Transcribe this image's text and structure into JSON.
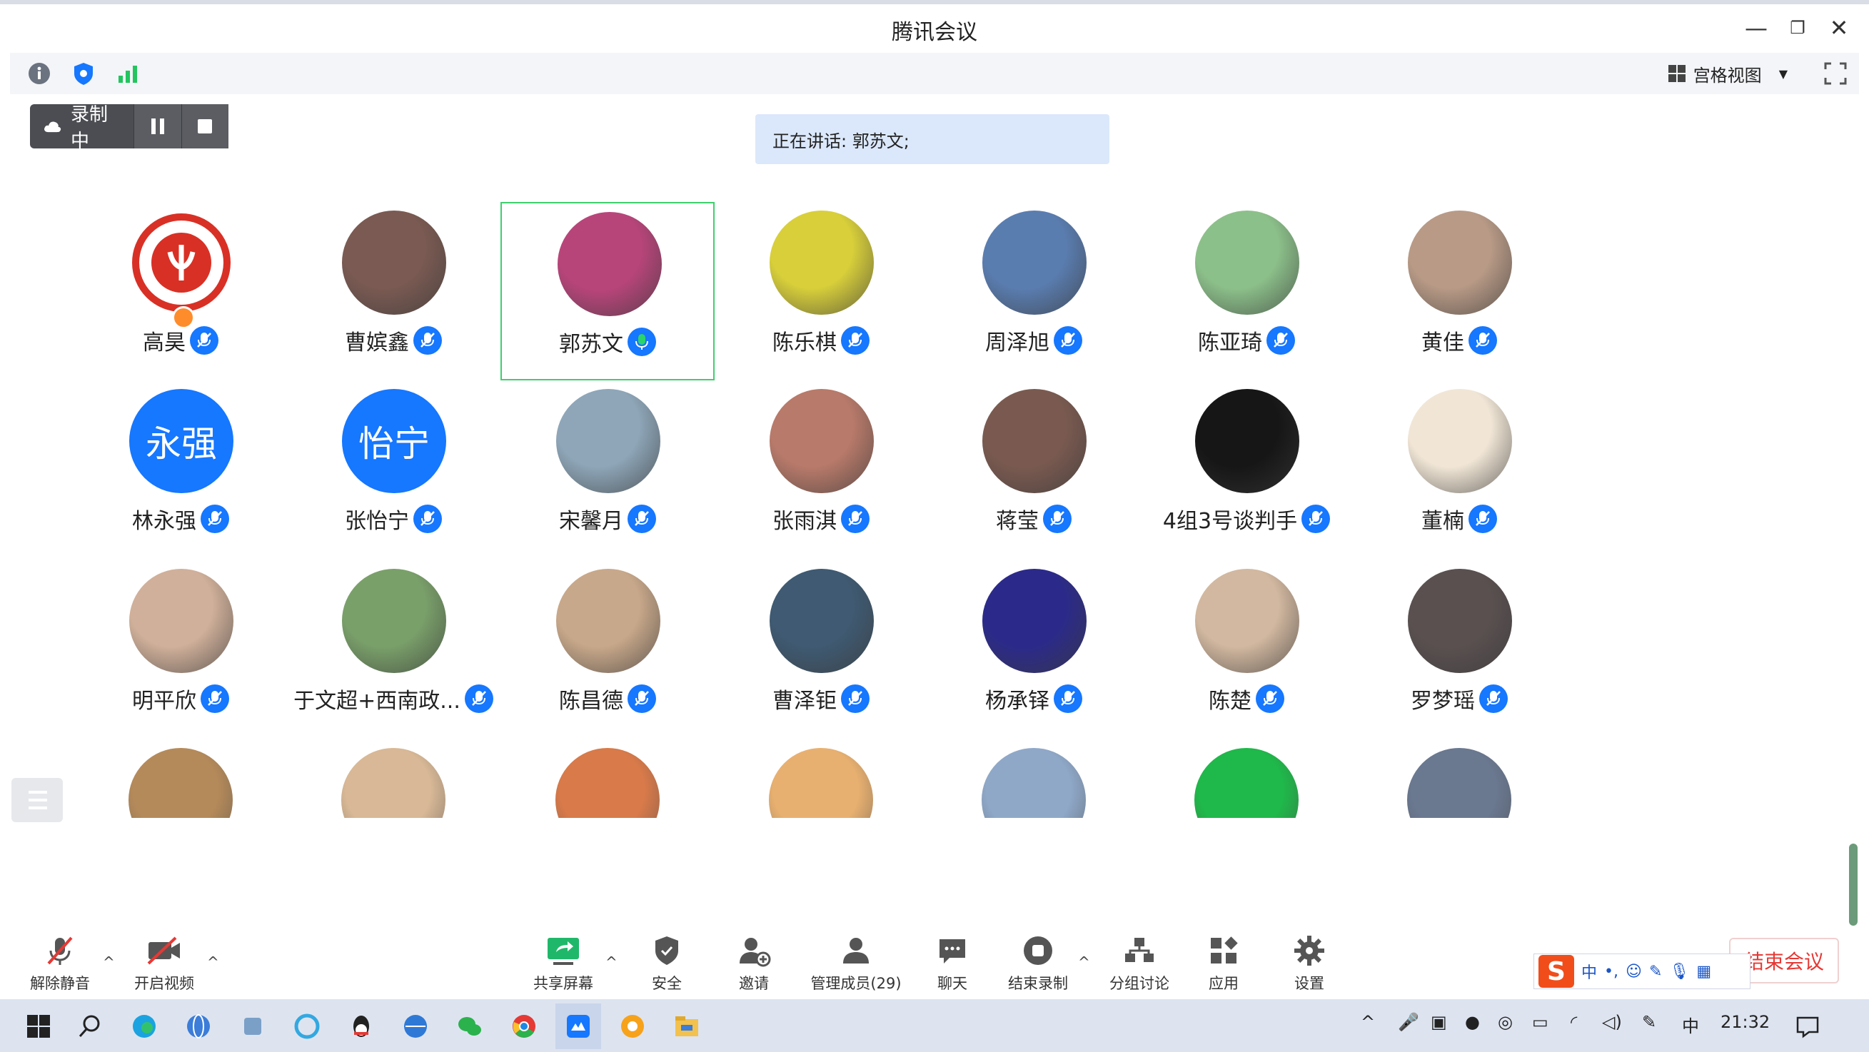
{
  "window": {
    "title": "腾讯会议"
  },
  "toolbar": {
    "info_icon": "info-icon",
    "security_icon": "shield-icon",
    "signal_icon": "signal-icon",
    "view_mode": "宫格视图"
  },
  "recording": {
    "label": "录制中"
  },
  "speaking": {
    "text": "正在讲话: 郭苏文;"
  },
  "participants": [
    {
      "name": "高昊",
      "avatar": "logo"
    },
    {
      "name": "曹嫔鑫",
      "avatar": "photo"
    },
    {
      "name": "郭苏文",
      "avatar": "photo",
      "speaking": true
    },
    {
      "name": "陈乐棋",
      "avatar": "photo"
    },
    {
      "name": "周泽旭",
      "avatar": "photo"
    },
    {
      "name": "陈亚琦",
      "avatar": "photo"
    },
    {
      "name": "黄佳",
      "avatar": "photo"
    },
    {
      "name": "林永强",
      "avatar": "text",
      "avatar_text": "永强"
    },
    {
      "name": "张怡宁",
      "avatar": "text",
      "avatar_text": "怡宁"
    },
    {
      "name": "宋馨月",
      "avatar": "photo"
    },
    {
      "name": "张雨淇",
      "avatar": "photo"
    },
    {
      "name": "蒋莹",
      "avatar": "photo"
    },
    {
      "name": "4组3号谈判手",
      "avatar": "photo"
    },
    {
      "name": "董楠",
      "avatar": "photo"
    },
    {
      "name": "明平欣",
      "avatar": "photo"
    },
    {
      "name": "于文超+西南政...",
      "avatar": "photo"
    },
    {
      "name": "陈昌德",
      "avatar": "photo"
    },
    {
      "name": "曹泽钜",
      "avatar": "photo"
    },
    {
      "name": "杨承铎",
      "avatar": "photo"
    },
    {
      "name": "陈楚",
      "avatar": "photo"
    },
    {
      "name": "罗梦瑶",
      "avatar": "photo"
    }
  ],
  "bottom": {
    "unmute": "解除静音",
    "video": "开启视频",
    "share": "共享屏幕",
    "security": "安全",
    "invite": "邀请",
    "members": "管理成员(29)",
    "chat": "聊天",
    "stop_record": "结束录制",
    "breakout": "分组讨论",
    "apps": "应用",
    "settings": "设置",
    "end": "结束会议"
  },
  "ime": {
    "lang": "中"
  },
  "taskbar": {
    "time": "21:32",
    "ime_lang": "中"
  },
  "colors": {
    "accent": "#1677ff",
    "speaker_border": "#3ecf6d",
    "end": "#e53935"
  }
}
